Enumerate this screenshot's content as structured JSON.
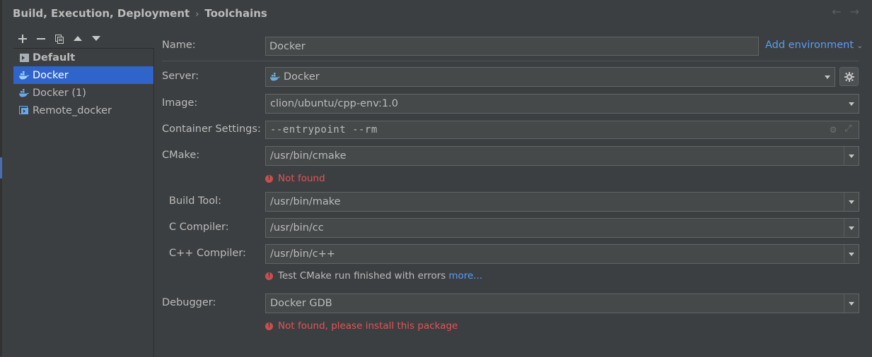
{
  "breadcrumb": {
    "parent": "Build, Execution, Deployment",
    "separator": "›",
    "current": "Toolchains"
  },
  "nav": {
    "back_icon": "←",
    "forward_icon": "→"
  },
  "toolbar": {
    "icons": [
      "add-icon",
      "remove-icon",
      "copy-icon",
      "move-up-icon",
      "move-down-icon"
    ]
  },
  "tree": {
    "items": [
      {
        "label": "Default",
        "icon": "terminal-icon",
        "bold": true,
        "selected": false
      },
      {
        "label": "Docker",
        "icon": "docker-icon",
        "bold": false,
        "selected": true
      },
      {
        "label": "Docker (1)",
        "icon": "docker-icon",
        "bold": false,
        "selected": false
      },
      {
        "label": "Remote_docker",
        "icon": "remote-icon",
        "bold": false,
        "selected": false
      }
    ]
  },
  "form": {
    "name_label": "Name:",
    "name_value": "Docker",
    "add_environment": "Add environment",
    "server_label": "Server:",
    "server_value": "Docker",
    "image_label": "Image:",
    "image_value": "clion/ubuntu/cpp-env:1.0",
    "container_label": "Container Settings:",
    "container_value": "--entrypoint --rm",
    "cmake_label": "CMake:",
    "cmake_value": "/usr/bin/cmake",
    "cmake_error": "Not found",
    "build_tool_label": "Build Tool:",
    "build_tool_value": "/usr/bin/make",
    "c_compiler_label": "C Compiler:",
    "c_compiler_value": "/usr/bin/cc",
    "cpp_compiler_label": "C++ Compiler:",
    "cpp_compiler_value": "/usr/bin/c++",
    "test_message": "Test CMake run finished with errors",
    "test_more": "more...",
    "debugger_label": "Debugger:",
    "debugger_value": "Docker GDB",
    "debugger_error": "Not found, please install this package"
  },
  "colors": {
    "background": "#3c3f41",
    "selection": "#2f65ca",
    "error": "#e05555",
    "link": "#589df6"
  }
}
